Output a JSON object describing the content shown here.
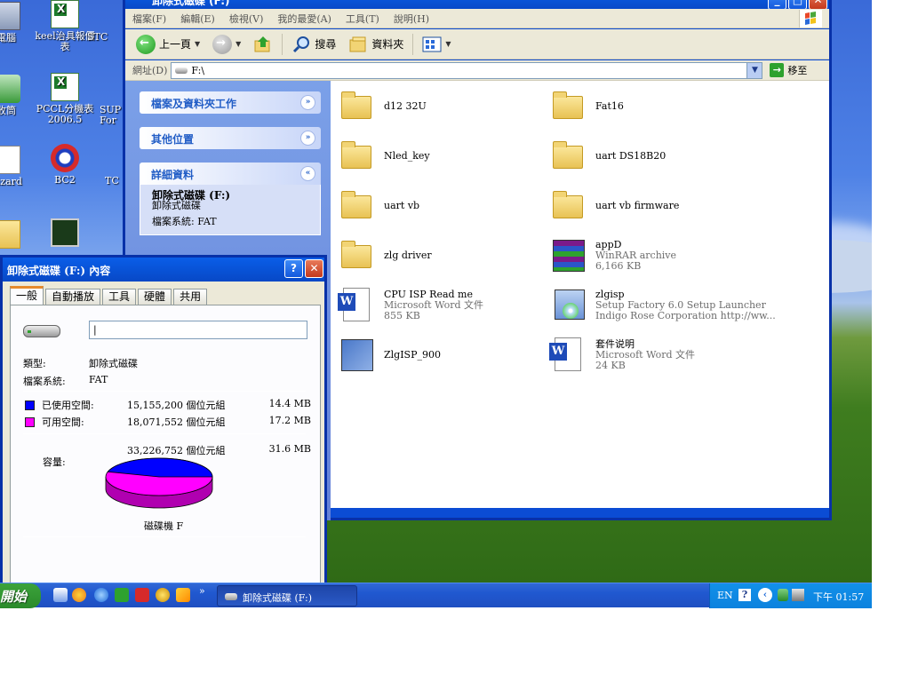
{
  "desktop": {
    "icons": [
      {
        "label": "電腦"
      },
      {
        "label": "keel治具報價表"
      },
      {
        "label": "STC"
      },
      {
        "label": "收筒"
      },
      {
        "label": "PCCL分機表 2006.5"
      },
      {
        "label": "SUP For"
      },
      {
        "label": "Vizard"
      },
      {
        "label": "BC2"
      },
      {
        "label": "TC"
      }
    ]
  },
  "explorer": {
    "title": "卸除式磁碟 (F:)",
    "menu": [
      "檔案(F)",
      "編輯(E)",
      "檢視(V)",
      "我的最愛(A)",
      "工具(T)",
      "說明(H)"
    ],
    "toolbar": {
      "back": "上一頁",
      "search": "搜尋",
      "folders": "資料夾"
    },
    "address": {
      "label": "網址(D)",
      "value": "F:\\",
      "go": "移至"
    },
    "taskpane": {
      "file_tasks": "檔案及資料夾工作",
      "other_places": "其他位置",
      "details": "詳細資料",
      "detail_name": "卸除式磁碟 (F:)",
      "detail_type": "卸除式磁碟",
      "detail_fs": "檔案系統: FAT"
    },
    "files": [
      {
        "name": "d12 32U",
        "kind": "folder"
      },
      {
        "name": "Fat16",
        "kind": "folder"
      },
      {
        "name": "Nled_key",
        "kind": "folder"
      },
      {
        "name": "uart DS18B20",
        "kind": "folder"
      },
      {
        "name": "uart vb",
        "kind": "folder"
      },
      {
        "name": "uart vb firmware",
        "kind": "folder"
      },
      {
        "name": "zlg driver",
        "kind": "folder"
      },
      {
        "name": "appD",
        "kind": "rar",
        "line2": "WinRAR archive",
        "line3": "6,166 KB"
      },
      {
        "name": "CPU ISP Read me",
        "kind": "word",
        "line2": "Microsoft Word 文件",
        "line3": "855 KB"
      },
      {
        "name": "zlgisp",
        "kind": "setup",
        "line2": "Setup Factory 6.0 Setup Launcher",
        "line3": "Indigo Rose Corporation http://ww..."
      },
      {
        "name": "ZlgISP_900",
        "kind": "exe"
      },
      {
        "name": "套件说明",
        "kind": "word",
        "line2": "Microsoft Word 文件",
        "line3": "24 KB"
      }
    ]
  },
  "properties": {
    "title": "卸除式磁碟 (F:) 內容",
    "tabs": [
      "一般",
      "自動播放",
      "工具",
      "硬體",
      "共用"
    ],
    "name_value": "|",
    "type_label": "類型:",
    "type_value": "卸除式磁碟",
    "fs_label": "檔案系統:",
    "fs_value": "FAT",
    "used_label": "已使用空間:",
    "used_bytes": "15,155,200 個位元組",
    "used_size": "14.4 MB",
    "free_label": "可用空間:",
    "free_bytes": "18,071,552 個位元組",
    "free_size": "17.2 MB",
    "capacity_label": "容量:",
    "capacity_bytes": "33,226,752 個位元組",
    "capacity_size": "31.6 MB",
    "drive_label": "磁碟機 F",
    "used_color": "#0000ff",
    "free_color": "#ff00ff",
    "used_fraction": 0.456
  },
  "taskbar": {
    "start": "開始",
    "task": "卸除式磁碟 (F:)",
    "lang": "EN",
    "time": "下午 01:57"
  }
}
